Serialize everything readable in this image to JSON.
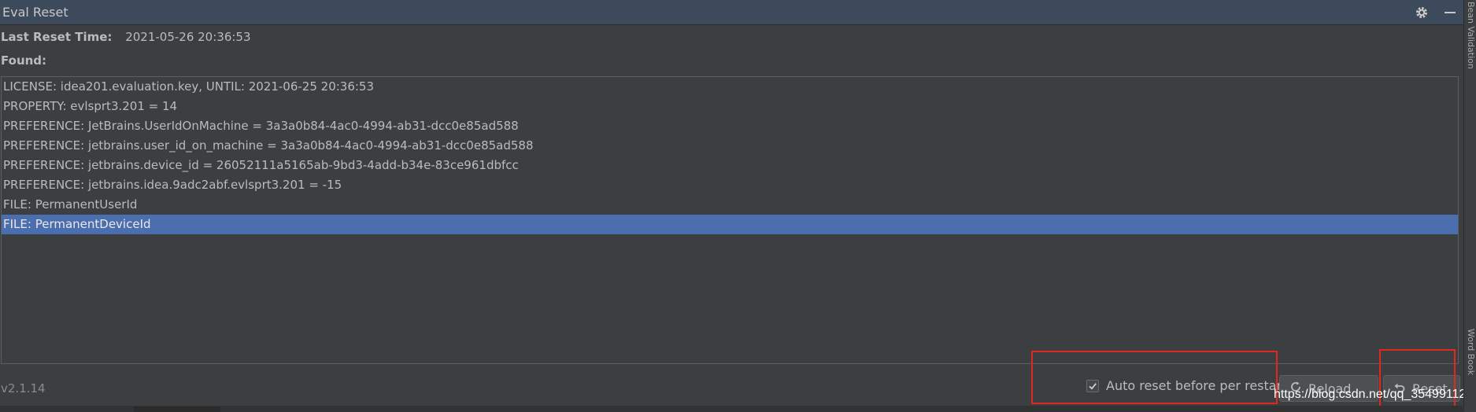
{
  "window": {
    "title": "Eval Reset"
  },
  "info": {
    "last_reset_label": "Last Reset Time:",
    "last_reset_value": "2021-05-26 20:36:53",
    "found_label": "Found:"
  },
  "items": [
    {
      "text": "LICENSE: idea201.evaluation.key, UNTIL: 2021-06-25 20:36:53"
    },
    {
      "text": "PROPERTY: evlsprt3.201 = 14"
    },
    {
      "text": "PREFERENCE: JetBrains.UserIdOnMachine = 3a3a0b84-4ac0-4994-ab31-dcc0e85ad588"
    },
    {
      "text": "PREFERENCE: jetbrains.user_id_on_machine = 3a3a0b84-4ac0-4994-ab31-dcc0e85ad588"
    },
    {
      "text": "PREFERENCE: jetbrains.device_id = 26052111a5165ab-9bd3-4add-b34e-83ce961dbfcc"
    },
    {
      "text": "PREFERENCE: jetbrains.idea.9adc2abf.evlsprt3.201 = -15"
    },
    {
      "text": "FILE: PermanentUserId"
    },
    {
      "text": "FILE: PermanentDeviceId"
    }
  ],
  "selected_item": 7,
  "footer": {
    "version": "v2.1.14",
    "auto_reset_label": "Auto reset before per restart",
    "auto_reset_checked": true,
    "reload_label": "Reload",
    "reset_label": "Reset"
  },
  "watermark": "https://blog.csdn.net/qq_35499112",
  "side_tabs": {
    "top": "Bean Validation",
    "bottom": "Word Book"
  },
  "colors": {
    "background": "#3c3f41",
    "titlebar": "#3d4a5b",
    "selection": "#4b6eaf",
    "highlight": "#e0281e"
  },
  "icons": {
    "settings": "gear-icon",
    "minimize": "minimize-icon",
    "reload": "reload-icon",
    "reset": "undo-icon"
  }
}
